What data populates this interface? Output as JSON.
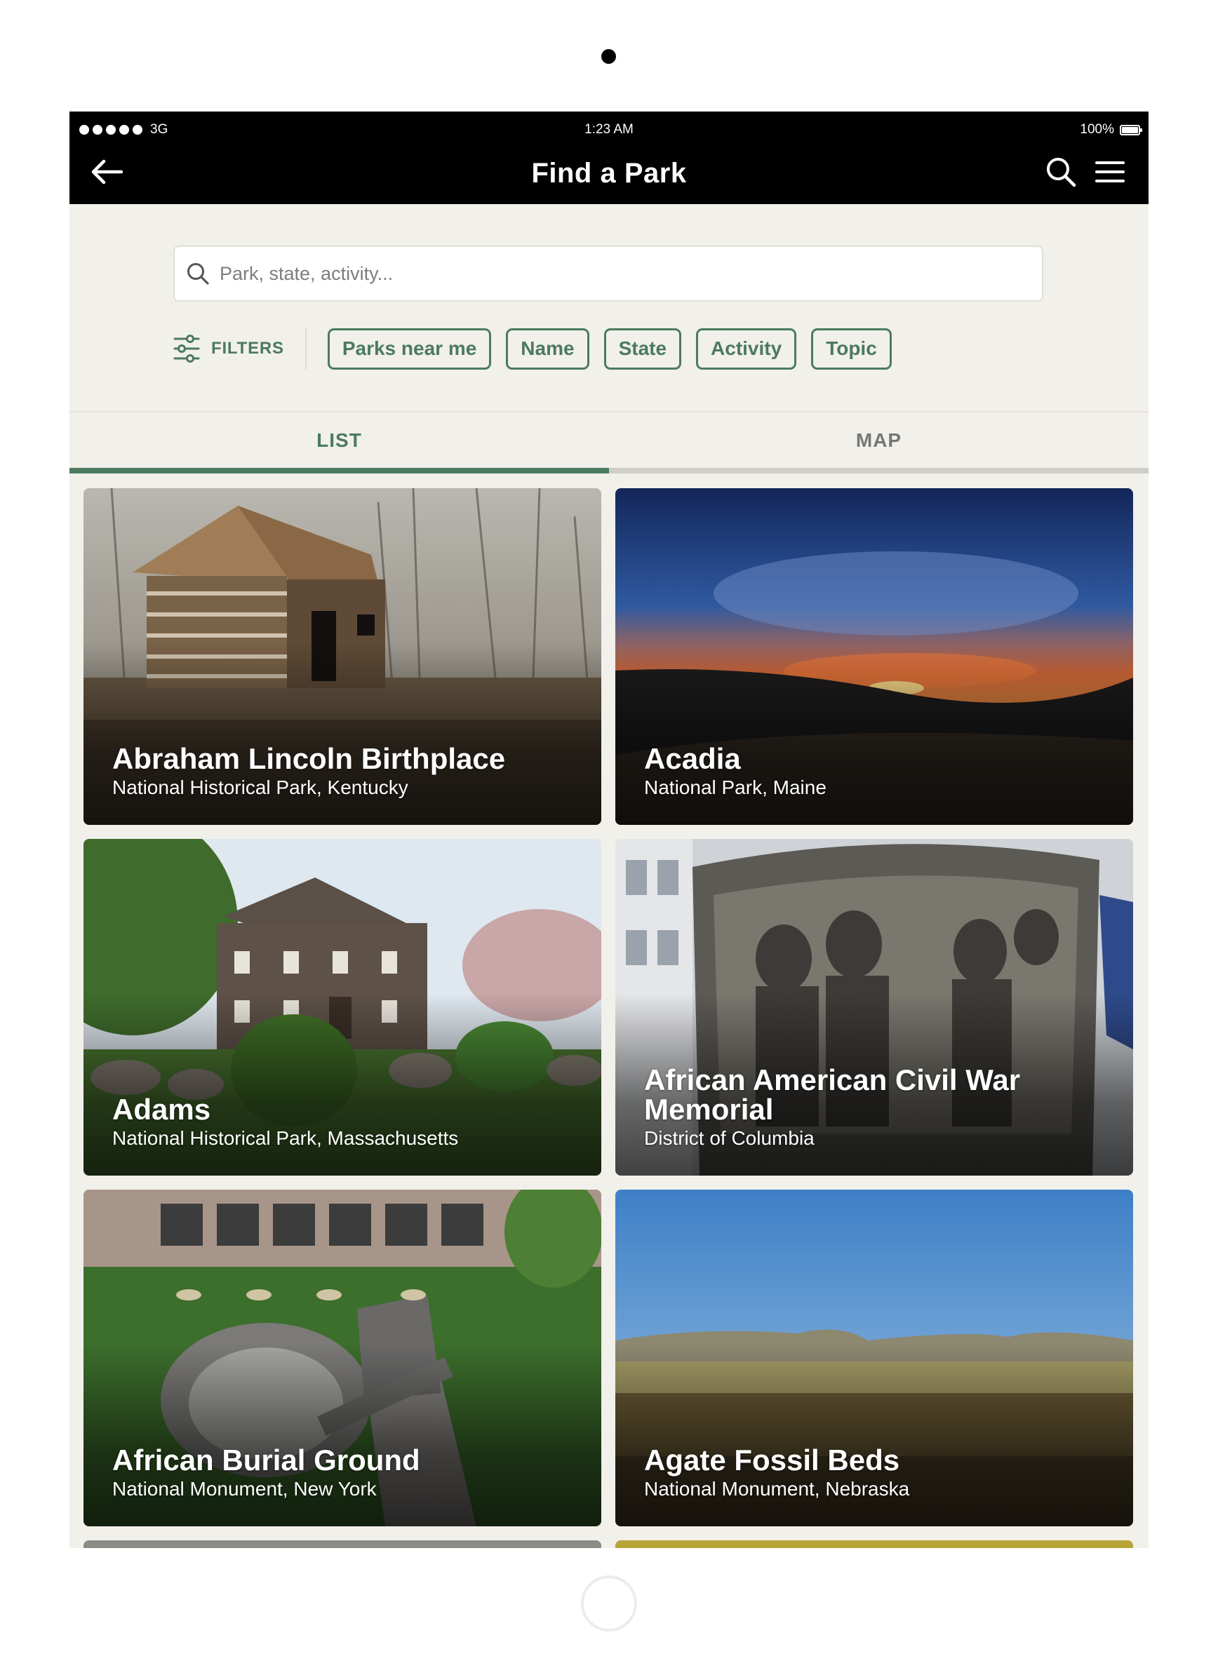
{
  "status_bar": {
    "network": "3G",
    "time": "1:23 AM",
    "battery": "100%"
  },
  "nav": {
    "title": "Find a Park",
    "back_icon": "arrow-left-icon",
    "search_icon": "search-icon",
    "menu_icon": "hamburger-menu-icon"
  },
  "search": {
    "placeholder": "Park, state, activity...",
    "value": ""
  },
  "filters": {
    "label": "FILTERS",
    "chips": [
      "Parks near me",
      "Name",
      "State",
      "Activity",
      "Topic"
    ]
  },
  "tabs": [
    {
      "label": "LIST",
      "active": true
    },
    {
      "label": "MAP",
      "active": false
    }
  ],
  "colors": {
    "accent": "#4c7a5e",
    "background": "#f1f0ea",
    "header": "#000000"
  },
  "parks": [
    {
      "name": "Abraham Lincoln Birthplace",
      "subtitle": "National Historical Park, Kentucky"
    },
    {
      "name": "Acadia",
      "subtitle": "National Park, Maine"
    },
    {
      "name": "Adams",
      "subtitle": "National Historical Park, Massachusetts"
    },
    {
      "name": "African American Civil War Memorial",
      "subtitle": "District of Columbia"
    },
    {
      "name": "African Burial Ground",
      "subtitle": "National Monument, New York"
    },
    {
      "name": "Agate Fossil Beds",
      "subtitle": "National Monument, Nebraska"
    }
  ]
}
